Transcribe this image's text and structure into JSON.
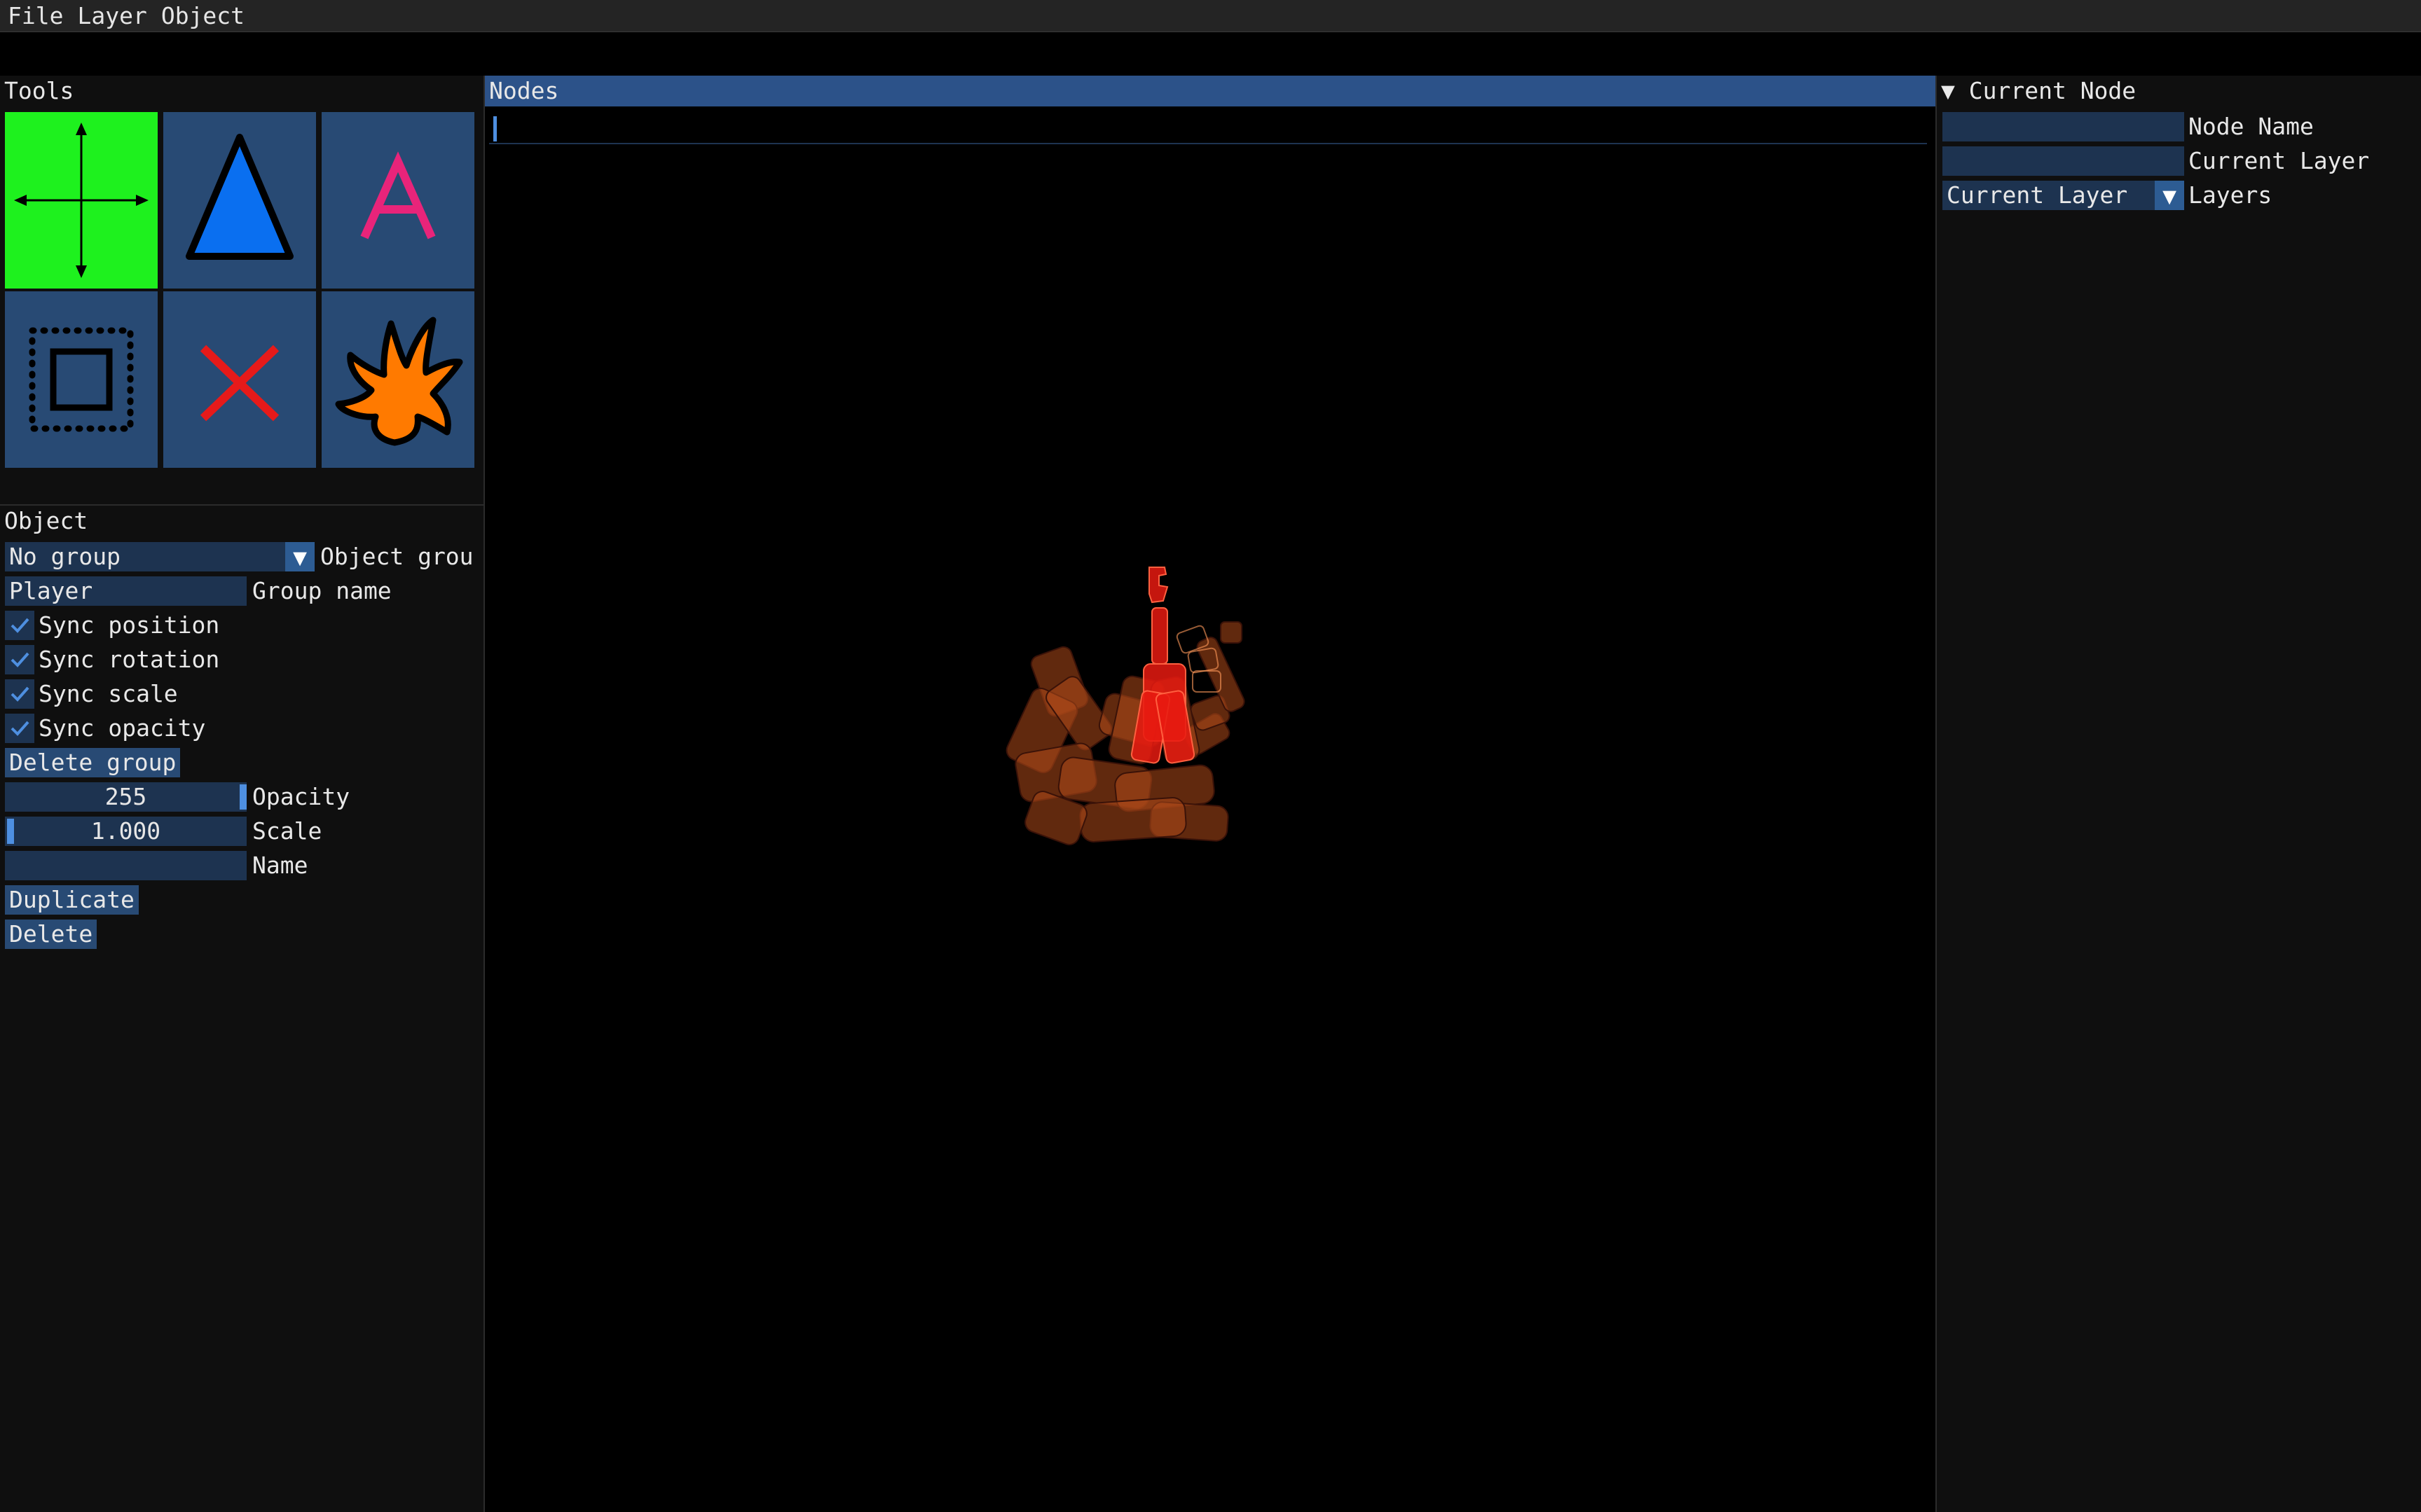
{
  "menu": [
    "File",
    "Layer",
    "Object"
  ],
  "tools_panel": {
    "title": "Tools",
    "tools": [
      {
        "name": "move",
        "icon": "move-arrows-icon",
        "active": true
      },
      {
        "name": "triangle",
        "icon": "triangle-icon",
        "active": false
      },
      {
        "name": "text",
        "icon": "text-a-icon",
        "glyph": "A",
        "active": false
      },
      {
        "name": "select",
        "icon": "selection-rect-icon",
        "active": false
      },
      {
        "name": "delete",
        "icon": "red-x-icon",
        "glyph": "X",
        "active": false
      },
      {
        "name": "splat",
        "icon": "orange-splat-icon",
        "active": false
      }
    ]
  },
  "object_panel": {
    "title": "Object",
    "group_combo": {
      "value": "No group",
      "label": "Object grou"
    },
    "group_name": {
      "value": "Player",
      "label": "Group name"
    },
    "sync_position": {
      "label": "Sync position",
      "checked": true
    },
    "sync_rotation": {
      "label": "Sync rotation",
      "checked": true
    },
    "sync_scale": {
      "label": "Sync scale",
      "checked": true
    },
    "sync_opacity": {
      "label": "Sync opacity",
      "checked": true
    },
    "delete_group": "Delete group",
    "opacity": {
      "value": "255",
      "label": "Opacity"
    },
    "scale": {
      "value": "1.000",
      "label": "Scale"
    },
    "name": {
      "value": "",
      "label": "Name"
    },
    "duplicate": "Duplicate",
    "delete": "Delete"
  },
  "nodes_panel": {
    "title": "Nodes",
    "search_value": ""
  },
  "current_node": {
    "title": "Current Node",
    "node_name": {
      "value": "",
      "label": "Node Name"
    },
    "current_layer": {
      "value": "",
      "label": "Current Layer"
    },
    "layers": {
      "value": "Current Layer",
      "label": "Layers"
    }
  },
  "colors": {
    "active_tool": "#1ef11e",
    "tool_bg": "#284a74",
    "field_bg": "#1d3350",
    "accent": "#4e8fe0",
    "header": "#2c5289"
  }
}
